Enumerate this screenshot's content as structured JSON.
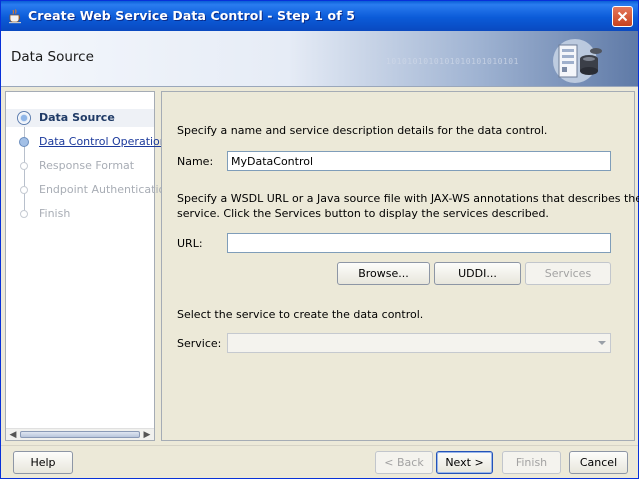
{
  "window": {
    "title": "Create Web Service Data Control - Step 1 of 5"
  },
  "header": {
    "page_title": "Data Source",
    "binary_text": "1010101010101010101010101"
  },
  "steps": [
    {
      "label": "Data Source",
      "state": "active"
    },
    {
      "label": "Data Control Operations",
      "state": "link"
    },
    {
      "label": "Response Format",
      "state": "disabled"
    },
    {
      "label": "Endpoint Authentication",
      "state": "disabled"
    },
    {
      "label": "Finish",
      "state": "disabled"
    }
  ],
  "main": {
    "intro": "Specify a name and service description details for the data control.",
    "name_label": "Name:",
    "name_value": "MyDataControl",
    "wsdl_text_1": "Specify a WSDL URL or a Java source file with JAX-WS annotations that describes the",
    "wsdl_text_2": "service. Click the Services button to display the services described.",
    "url_label": "URL:",
    "url_value": "",
    "browse_label": "Browse...",
    "uddi_label": "UDDI...",
    "services_label": "Services",
    "select_text": "Select the service to create the data control.",
    "service_label": "Service:",
    "service_value": ""
  },
  "footer": {
    "help_label": "Help",
    "back_label": "< Back",
    "next_label": "Next >",
    "finish_label": "Finish",
    "cancel_label": "Cancel"
  },
  "colors": {
    "titlebar": "#0b5bd8",
    "link": "#1c3a9c",
    "disabled_text": "#a8adb5"
  },
  "icons": [
    "coffee-cup-icon",
    "close-icon",
    "database-server-icon",
    "scroll-left-icon",
    "scroll-right-icon",
    "dropdown-caret-icon"
  ]
}
